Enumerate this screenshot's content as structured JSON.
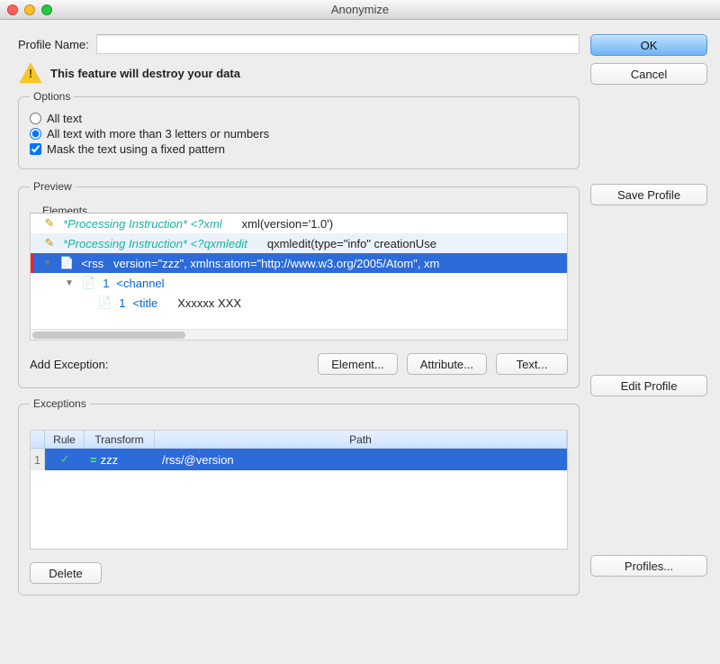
{
  "window": {
    "title": "Anonymize"
  },
  "profile": {
    "label": "Profile Name:",
    "value": ""
  },
  "warning": {
    "text": "This feature will destroy your data"
  },
  "options": {
    "legend": "Options",
    "all_text": {
      "label": "All text",
      "checked": false
    },
    "all_text_more": {
      "label": "All text with more than 3 letters or numbers",
      "checked": true
    },
    "mask_fixed": {
      "label": "Mask the text using a fixed pattern",
      "checked": true
    }
  },
  "preview": {
    "legend": "Preview",
    "elements_legend": "Elements",
    "rows": [
      {
        "pi": "*Processing Instruction* <?xml",
        "rest": "xml(version='1.0')"
      },
      {
        "pi": "*Processing Instruction* <?qxmledit",
        "rest": "qxmledit(type=\"info\"   creationUse"
      },
      {
        "sel": true,
        "tag": "<rss",
        "rest": "version=\"zzz\", xmlns:atom=\"http://www.w3.org/2005/Atom\", xm"
      },
      {
        "child": 1,
        "num": "1",
        "tag": "<channel"
      },
      {
        "child": 2,
        "num": "1",
        "tag": "<title",
        "rest": "Xxxxxx XXX"
      }
    ],
    "add_exception_label": "Add Exception:",
    "buttons": {
      "element": "Element...",
      "attribute": "Attribute...",
      "text": "Text..."
    }
  },
  "exceptions": {
    "legend": "Exceptions",
    "headers": {
      "rule": "Rule",
      "transform": "Transform",
      "path": "Path"
    },
    "row": {
      "index": "1",
      "transform": "zzz",
      "path": "/rss/@version"
    },
    "delete": "Delete"
  },
  "right": {
    "ok": "OK",
    "cancel": "Cancel",
    "save_profile": "Save Profile",
    "edit_profile": "Edit Profile",
    "profiles": "Profiles..."
  }
}
